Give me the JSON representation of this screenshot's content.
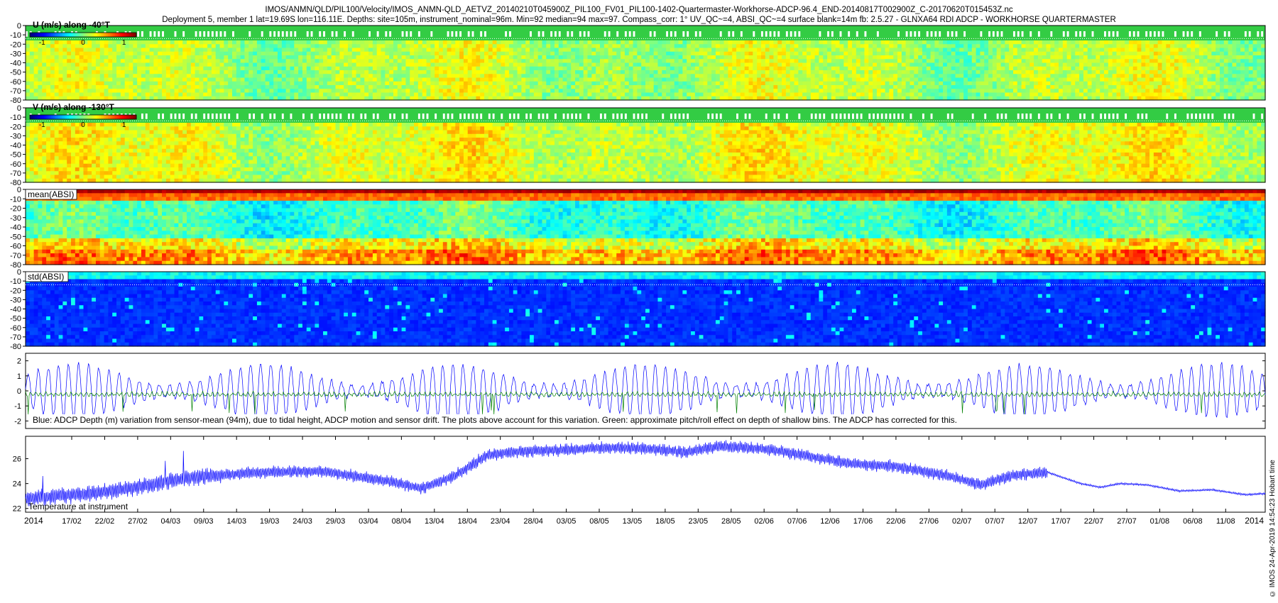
{
  "header": {
    "line1": "IMOS/ANMN/QLD/PIL100/Velocity/IMOS_ANMN-QLD_AETVZ_20140210T045900Z_PIL100_FV01_PIL100-1402-Quartermaster-Workhorse-ADCP-96.4_END-20140817T002900Z_C-20170620T015453Z.nc",
    "line2": "Deployment 5, member 1 lat=19.69S lon=116.11E. Depths: site=105m, instrument_nominal=96m. Min=92 median=94 max=97. Compass_corr: 1° UV_QC~=4, ABSI_QC~=4 surface blank=14m fb: 2.5.27 - GLNXA64 RDI ADCP - WORKHORSE QUARTERMASTER"
  },
  "side_text": {
    "imos": "© IMOS 24-Apr-2019 14:54:23 Hobart time"
  },
  "colors": {
    "line_blue": "#0000ff",
    "line_green": "#008000",
    "background": "#ffffff"
  },
  "chart_data": [
    {
      "type": "heatmap",
      "label": "U (m/s) along -40°T",
      "y_ticks": [
        0,
        -10,
        -20,
        -30,
        -40,
        -50,
        -60,
        -70,
        -80
      ],
      "ylim": [
        -80,
        0
      ],
      "colorbar": {
        "ticks": [
          "-1",
          "0",
          "1"
        ],
        "range": [
          -1.3,
          1.3
        ]
      },
      "mean_value": 0.05
    },
    {
      "type": "heatmap",
      "label": "V (m/s) along -130°T",
      "y_ticks": [
        0,
        -10,
        -20,
        -30,
        -40,
        -50,
        -60,
        -70,
        -80
      ],
      "ylim": [
        -80,
        0
      ],
      "colorbar": {
        "ticks": [
          "-1",
          "0",
          "1"
        ],
        "range": [
          -1.3,
          1.3
        ]
      },
      "mean_value": 0.1
    },
    {
      "type": "heatmap",
      "label": "mean(ABSI)",
      "y_ticks": [
        0,
        -10,
        -20,
        -30,
        -40,
        -50,
        -60,
        -70,
        -80
      ],
      "ylim": [
        -80,
        0
      ]
    },
    {
      "type": "heatmap",
      "label": "std(ABSI)",
      "y_ticks": [
        0,
        -10,
        -20,
        -30,
        -40,
        -50,
        -60,
        -70,
        -80
      ],
      "ylim": [
        -80,
        0
      ]
    },
    {
      "type": "line",
      "y_ticks": [
        2,
        1,
        0,
        -1,
        -2
      ],
      "ylim": [
        -2.5,
        2.5
      ],
      "series": [],
      "annotation": "Blue: ADCP Depth (m) variation from sensor-mean (94m), due to tidal height, ADCP motion and sensor drift. The plots above account for this variation. Green: approximate pitch/roll effect on depth of shallow bins. The ADCP has corrected for this."
    },
    {
      "type": "line",
      "y_ticks": [
        26,
        24,
        22
      ],
      "ylim": [
        21.7,
        27.8
      ],
      "label": "Temperature at instrument",
      "x_start_label": "2014",
      "x_end_label": "2014",
      "x_ticks": [
        "17/02",
        "22/02",
        "27/02",
        "04/03",
        "09/03",
        "14/03",
        "19/03",
        "24/03",
        "29/03",
        "03/04",
        "08/04",
        "13/04",
        "18/04",
        "23/04",
        "28/04",
        "03/05",
        "08/05",
        "13/05",
        "18/05",
        "23/05",
        "28/05",
        "02/06",
        "07/06",
        "12/06",
        "17/06",
        "22/06",
        "27/06",
        "02/07",
        "07/07",
        "12/07",
        "17/07",
        "22/07",
        "27/07",
        "01/08",
        "06/08",
        "11/08"
      ],
      "x_range_days": [
        0,
        188
      ],
      "first_tick_day": 7,
      "tick_step_days": 5,
      "series": [
        {
          "trend_days": [
            0,
            10,
            18,
            25,
            35,
            45,
            55,
            60,
            65,
            70,
            75,
            82,
            88,
            95,
            100,
            105,
            112,
            118,
            125,
            132,
            140,
            145,
            150,
            155,
            160,
            163,
            166,
            170,
            175,
            180,
            185,
            188
          ],
          "trend_temp": [
            22.8,
            23.2,
            23.8,
            24.5,
            24.9,
            25.0,
            24.2,
            23.6,
            24.6,
            26.3,
            26.6,
            26.7,
            26.9,
            26.8,
            26.5,
            27.0,
            26.8,
            26.3,
            25.6,
            25.4,
            24.6,
            23.9,
            24.7,
            24.9,
            24.0,
            23.7,
            24.0,
            23.9,
            23.4,
            23.5,
            23.1,
            23.2
          ]
        }
      ]
    }
  ]
}
